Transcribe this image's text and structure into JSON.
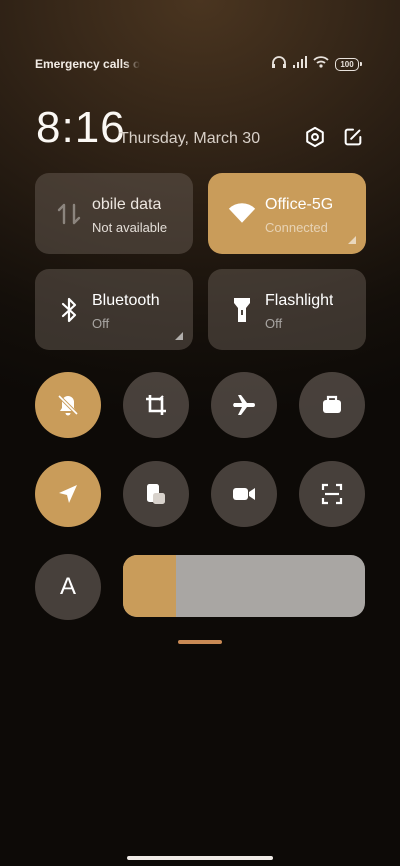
{
  "status_bar": {
    "carrier_text": "Emergency calls o",
    "battery_level": "100",
    "icons": [
      "headset-icon",
      "signal-icon",
      "wifi-icon",
      "battery-icon"
    ]
  },
  "header": {
    "time": "8:16",
    "date": "Thursday, March 30",
    "actions": [
      "settings-icon",
      "edit-icon"
    ]
  },
  "tiles": {
    "mobile_data": {
      "title": "obile data",
      "subtitle": "Not available",
      "active": false,
      "icon": "data-arrows-icon"
    },
    "wifi": {
      "title": "Office-5G",
      "subtitle": "Connected",
      "active": true,
      "icon": "wifi-icon"
    },
    "bluetooth": {
      "title": "Bluetooth",
      "subtitle": "Off",
      "active": false,
      "icon": "bluetooth-icon"
    },
    "flashlight": {
      "title": "Flashlight",
      "subtitle": "Off",
      "active": false,
      "icon": "flashlight-icon"
    }
  },
  "toggles": [
    {
      "name": "silent",
      "icon": "bell-off-icon",
      "active": true
    },
    {
      "name": "screenshot",
      "icon": "crop-icon",
      "active": false
    },
    {
      "name": "airplane-mode",
      "icon": "airplane-icon",
      "active": false
    },
    {
      "name": "work-mode",
      "icon": "briefcase-icon",
      "active": false
    },
    {
      "name": "location",
      "icon": "location-arrow-icon",
      "active": true
    },
    {
      "name": "floating-window",
      "icon": "floating-window-icon",
      "active": false
    },
    {
      "name": "screen-recorder",
      "icon": "video-camera-icon",
      "active": false
    },
    {
      "name": "scanner",
      "icon": "scan-icon",
      "active": false
    },
    {
      "name": "font-size",
      "icon": "font-icon",
      "active": false
    }
  ],
  "font_toggle": {
    "letter": "A"
  },
  "brightness": {
    "level": 0.22
  },
  "colors": {
    "accent": "#c99c5a",
    "tile_bg": "#4b443e",
    "slider_track": "#a9a6a3"
  }
}
